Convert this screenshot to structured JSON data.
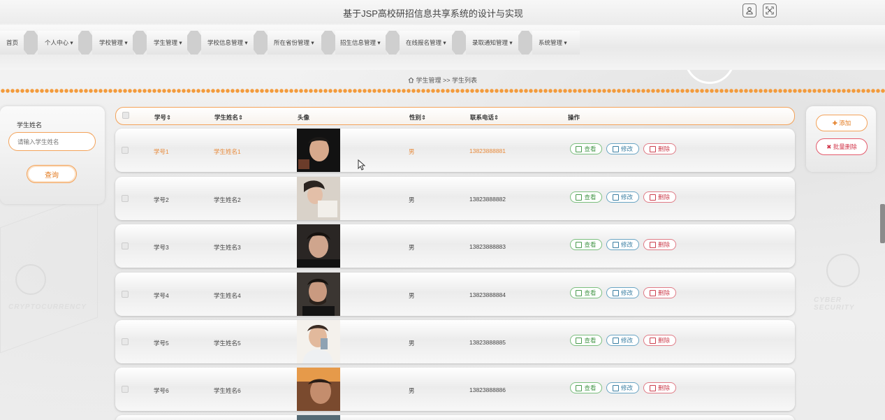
{
  "window": {
    "title": "基于JSP高校研招信息共享系统的设计与实现"
  },
  "nav": {
    "items": [
      {
        "label": "首页"
      },
      {
        "label": "个人中心 ▾"
      },
      {
        "label": "学校管理 ▾"
      },
      {
        "label": "学生管理 ▾"
      },
      {
        "label": "学校信息管理 ▾"
      },
      {
        "label": "所在省份管理 ▾"
      },
      {
        "label": "招生信息管理 ▾"
      },
      {
        "label": "在线报名管理 ▾"
      },
      {
        "label": "录取通知管理 ▾"
      },
      {
        "label": "系统管理 ▾"
      }
    ]
  },
  "breadcrumb": {
    "section": "学生管理",
    "sep": ">>",
    "page": "学生列表"
  },
  "search": {
    "label": "学生姓名",
    "placeholder": "请输入学生姓名",
    "button": "查询"
  },
  "actions": {
    "add": "✚ 添加",
    "batch_delete": "✖ 批量删除"
  },
  "table": {
    "headers": {
      "id": "学号⇕",
      "name": "学生姓名⇕",
      "avatar": "头像",
      "gender": "性别⇕",
      "phone": "联系电话⇕",
      "ops": "操作"
    },
    "ops": {
      "view": "查看",
      "edit": "修改",
      "delete": "删除"
    },
    "rows": [
      {
        "id": "学号1",
        "name": "学生姓名1",
        "gender": "男",
        "phone": "13823888881"
      },
      {
        "id": "学号2",
        "name": "学生姓名2",
        "gender": "男",
        "phone": "13823888882"
      },
      {
        "id": "学号3",
        "name": "学生姓名3",
        "gender": "男",
        "phone": "13823888883"
      },
      {
        "id": "学号4",
        "name": "学生姓名4",
        "gender": "男",
        "phone": "13823888884"
      },
      {
        "id": "学号5",
        "name": "学生姓名5",
        "gender": "男",
        "phone": "13823888885"
      },
      {
        "id": "学号6",
        "name": "学生姓名6",
        "gender": "男",
        "phone": "13823888886"
      }
    ]
  },
  "background": {
    "left_text": "CRYPTOCURRENCY",
    "right_text": "CYBER SECURITY"
  },
  "colors": {
    "accent": "#f3a259",
    "view": "#4a9a4e",
    "edit": "#3a7ea2",
    "delete": "#cc3f4e"
  }
}
